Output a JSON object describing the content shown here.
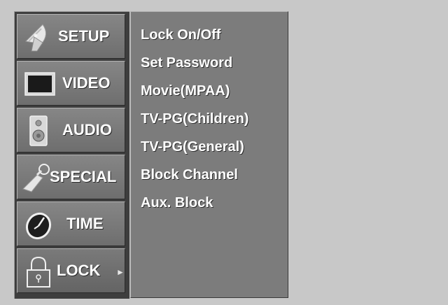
{
  "menu": {
    "items": [
      {
        "label": "SETUP",
        "icon": "satellite-dish-icon"
      },
      {
        "label": "VIDEO",
        "icon": "tv-screen-icon"
      },
      {
        "label": "AUDIO",
        "icon": "speaker-icon"
      },
      {
        "label": "SPECIAL",
        "icon": "key-icon"
      },
      {
        "label": "TIME",
        "icon": "clock-icon"
      },
      {
        "label": "LOCK",
        "icon": "padlock-icon",
        "active": true
      }
    ],
    "active_arrow": "►"
  },
  "submenu": {
    "items": [
      "Lock On/Off",
      "Set Password",
      "Movie(MPAA)",
      "TV-PG(Children)",
      "TV-PG(General)",
      "Block Channel",
      "Aux. Block"
    ]
  },
  "colors": {
    "background": "#c8c8c8",
    "menu_panel": "#3e3e3e",
    "menu_tile": "#7a7a7a",
    "submenu_panel": "#7c7c7c",
    "text": "#ffffff"
  }
}
